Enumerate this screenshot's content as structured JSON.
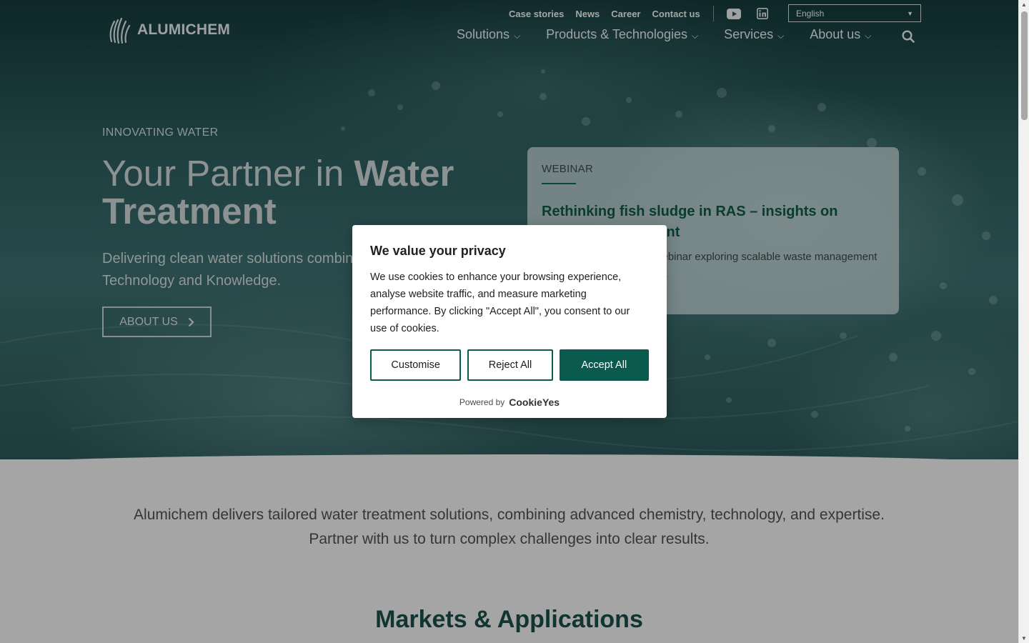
{
  "header": {
    "logo_text": "ALUMICHEM",
    "top_links": [
      "Case stories",
      "News",
      "Career",
      "Contact us"
    ],
    "language": "English",
    "nav": [
      "Solutions",
      "Products & Technologies",
      "Services",
      "About us"
    ]
  },
  "hero": {
    "eyebrow": "INNOVATING WATER",
    "headline_light": "Your Partner in ",
    "headline_bold_1": "Water",
    "headline_bold_2": "Treatment",
    "subtitle": "Delivering clean water solutions combining Chemistry, Technology and Knowledge.",
    "button_label": "ABOUT US"
  },
  "webinar_card": {
    "tag": "WEBINAR",
    "title": "Rethinking fish sludge in RAS – insights on sludge management",
    "description": "Join us for an insightful webinar exploring scalable waste management for landbased fish farming."
  },
  "intro": {
    "text": "Alumichem delivers tailored water treatment solutions, combining advanced chemistry, technology, and expertise. Partner with us to turn complex challenges into clear results."
  },
  "markets": {
    "title": "Markets & Applications"
  },
  "cookie_dialog": {
    "title": "We value your privacy",
    "text": "We use cookies to enhance your browsing experience, analyse website traffic, and measure marketing performance. By clicking \"Accept All\", you consent to our use of cookies.",
    "buttons": {
      "customise": "Customise",
      "reject": "Reject All",
      "accept": "Accept All"
    },
    "powered_by": "Powered by",
    "powered_brand": "CookieYes"
  },
  "colors": {
    "accent": "#0b5a4e",
    "card_title": "#0c5a45",
    "markets_title": "#1a4f47"
  }
}
